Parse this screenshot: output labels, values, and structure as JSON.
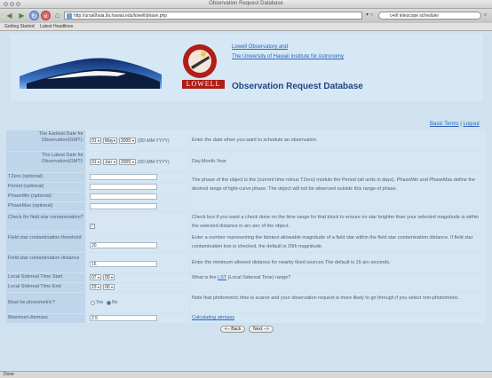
{
  "window": {
    "title": "Observation Request Database"
  },
  "browser": {
    "url": "http://ursa6hala.ifa.hawaii.edu/lowell/phase.php",
    "search_placeholder": "c•ell telescope scheduler",
    "bookmarks": [
      "Getting Started",
      "Latest Headlines"
    ],
    "status": "Done"
  },
  "header": {
    "logo_text": "LOWELL",
    "link_lowell": "Lowell Observatory and",
    "link_ifa": "The University of Hawaii Institute for Astronomy",
    "title": "Observation Request Database",
    "link_terms": "Basic Terms",
    "separator": "|",
    "link_logout": "Logout"
  },
  "form": {
    "earliest_date": {
      "label": "The Earliest Date for Observation(GMT):",
      "day": "01",
      "month": "May",
      "year": "2005",
      "format": "(DD-MM-YYYY)",
      "desc": "Enter the date when you want to schedule an observation."
    },
    "latest_date": {
      "label": "The Latest Date for Observation(GMT):",
      "day": "01",
      "month": "Jun",
      "year": "2005",
      "format": "(DD-MM-YYYY)",
      "desc": "Day.Month.Year"
    },
    "tzero": {
      "label": "TZero (optional)",
      "value": ""
    },
    "period": {
      "label": "Period (optional)",
      "value": ""
    },
    "phasemin": {
      "label": "PhaseMin (optional)",
      "value": ""
    },
    "phasemax": {
      "label": "PhaseMax (optional)",
      "value": ""
    },
    "phase_desc": "The phase of the object is the (current time minus TZero) modulo the Period (all units in days). PhaseMin and PhaseMax define the desired range of light-curve phase. The object will not be observed outside this range of phase.",
    "field_check": {
      "label": "Check for field star contamination?",
      "checked": "✓",
      "desc": "Check box if you want a check done on the time range for that block to ensure no star brighter than your selected magnitude is within the selected distance in arc-sec of the object."
    },
    "field_mag": {
      "label": "Field star contamination threshold",
      "value": "20",
      "desc": "Enter a number representing the faintest allowable magnitude of a field star within the field star contamination distance. If field star contamination box is checked, the default is 20th magnitude."
    },
    "field_dist": {
      "label": "Field star contamination distance",
      "value": "15",
      "desc": "Enter the minimum allowed distance for nearby fixed sources The default is 15 arc-seconds."
    },
    "lst_start": {
      "label": "Local Sidereal Time Start",
      "hour": "07",
      "min": "00",
      "desc_pre": "What is the ",
      "desc_link": "LST",
      "desc_post": " (Local Sidereal Time) range?"
    },
    "lst_end": {
      "label": "Local Sidereal Time End",
      "hour": "23",
      "min": "00"
    },
    "photometric": {
      "label": "Must be photometric?",
      "yes": "Yes",
      "no": "No",
      "selected": "No",
      "desc": "Note that photometric time is scarce and your observation request is more likely to go through if you select non-photometric."
    },
    "airmass": {
      "label": "Maximum Airmass",
      "value": "2.5",
      "desc_link": "Calculating airmass"
    }
  },
  "buttons": {
    "back": "<-- Back",
    "next": "Next -->"
  }
}
